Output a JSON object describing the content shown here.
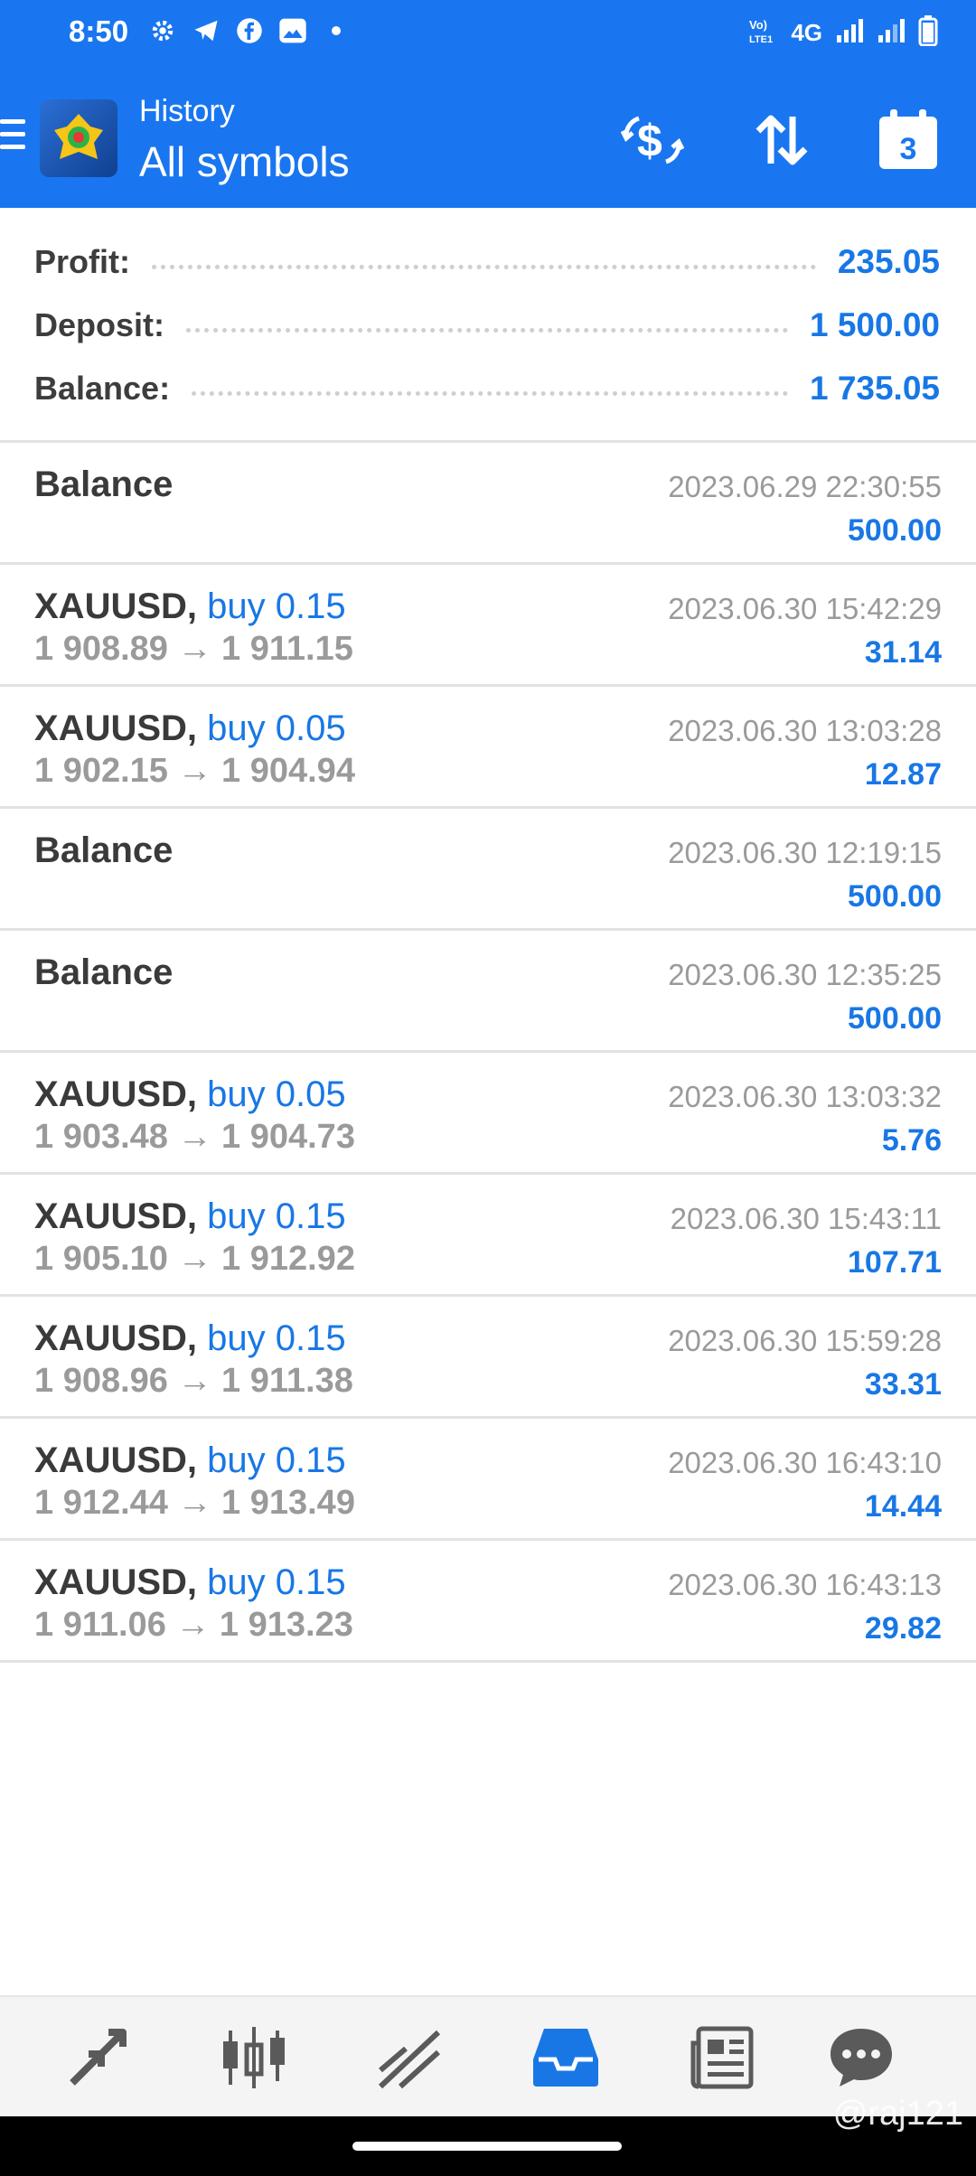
{
  "status_bar": {
    "time": "8:50",
    "network_label": "4G",
    "icons": [
      "settings-icon",
      "telegram-icon",
      "facebook-icon",
      "gallery-icon",
      "dot-icon",
      "volte-icon",
      "signal-icon",
      "signal-icon",
      "battery-icon"
    ]
  },
  "header": {
    "subtitle": "History",
    "title": "All symbols",
    "calendar_day": "3",
    "actions": [
      "currency-exchange-icon",
      "sort-icon",
      "calendar-icon"
    ]
  },
  "summary": {
    "profit_label": "Profit:",
    "profit_value": "235.05",
    "deposit_label": "Deposit:",
    "deposit_value": "1 500.00",
    "balance_label": "Balance:",
    "balance_value": "1 735.05"
  },
  "deals": [
    {
      "symbol": "Balance",
      "date": "2023.06.29 22:30:55",
      "profit": "500.00"
    },
    {
      "symbol": "XAUUSD,",
      "side": "buy 0.15",
      "prices": "1 908.89 → 1 911.15",
      "date": "2023.06.30 15:42:29",
      "profit": "31.14"
    },
    {
      "symbol": "XAUUSD,",
      "side": "buy 0.05",
      "prices": "1 902.15 → 1 904.94",
      "date": "2023.06.30 13:03:28",
      "profit": "12.87"
    },
    {
      "symbol": "Balance",
      "date": "2023.06.30 12:19:15",
      "profit": "500.00"
    },
    {
      "symbol": "Balance",
      "date": "2023.06.30 12:35:25",
      "profit": "500.00"
    },
    {
      "symbol": "XAUUSD,",
      "side": "buy 0.05",
      "prices": "1 903.48 → 1 904.73",
      "date": "2023.06.30 13:03:32",
      "profit": "5.76"
    },
    {
      "symbol": "XAUUSD,",
      "side": "buy 0.15",
      "prices": "1 905.10 → 1 912.92",
      "date": "2023.06.30 15:43:11",
      "profit": "107.71"
    },
    {
      "symbol": "XAUUSD,",
      "side": "buy 0.15",
      "prices": "1 908.96 → 1 911.38",
      "date": "2023.06.30 15:59:28",
      "profit": "33.31"
    },
    {
      "symbol": "XAUUSD,",
      "side": "buy 0.15",
      "prices": "1 912.44 → 1 913.49",
      "date": "2023.06.30 16:43:10",
      "profit": "14.44"
    },
    {
      "symbol": "XAUUSD,",
      "side": "buy 0.15",
      "prices": "1 911.06 → 1 913.23",
      "date": "2023.06.30 16:43:13",
      "profit": "29.82"
    }
  ],
  "bottom_nav": {
    "items": [
      "quotes-icon",
      "chart-icon",
      "trade-icon",
      "history-icon",
      "news-icon",
      "messages-icon"
    ],
    "active": "history-icon"
  },
  "watermark": "@raj121",
  "colors": {
    "accent": "#1976f0",
    "value_blue": "#1877e5",
    "text_dark": "#3a3a3a",
    "text_gray": "#9a9a9a"
  }
}
